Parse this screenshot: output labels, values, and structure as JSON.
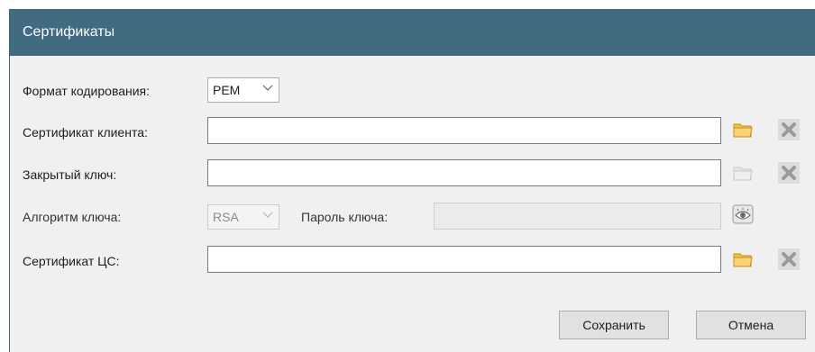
{
  "dialog": {
    "title": "Сертификаты",
    "title_bar_color": "#416b80"
  },
  "form": {
    "encoding_label": "Формат кодирования:",
    "encoding_value": "PEM",
    "client_cert_label": "Сертификат клиента:",
    "client_cert_value": "",
    "private_key_label": "Закрытый ключ:",
    "private_key_value": "",
    "key_algorithm_label": "Алгоритм ключа:",
    "key_algorithm_value": "RSA",
    "key_password_label": "Пароль ключа:",
    "key_password_value": "",
    "ca_cert_label": "Сертификат ЦС:",
    "ca_cert_value": ""
  },
  "icons": {
    "browse": "folder-icon",
    "clear": "clear-x-icon",
    "show_password": "eye-icon",
    "dropdown": "chevron-down-icon"
  },
  "buttons": {
    "save_label": "Сохранить",
    "cancel_label": "Отмена"
  }
}
